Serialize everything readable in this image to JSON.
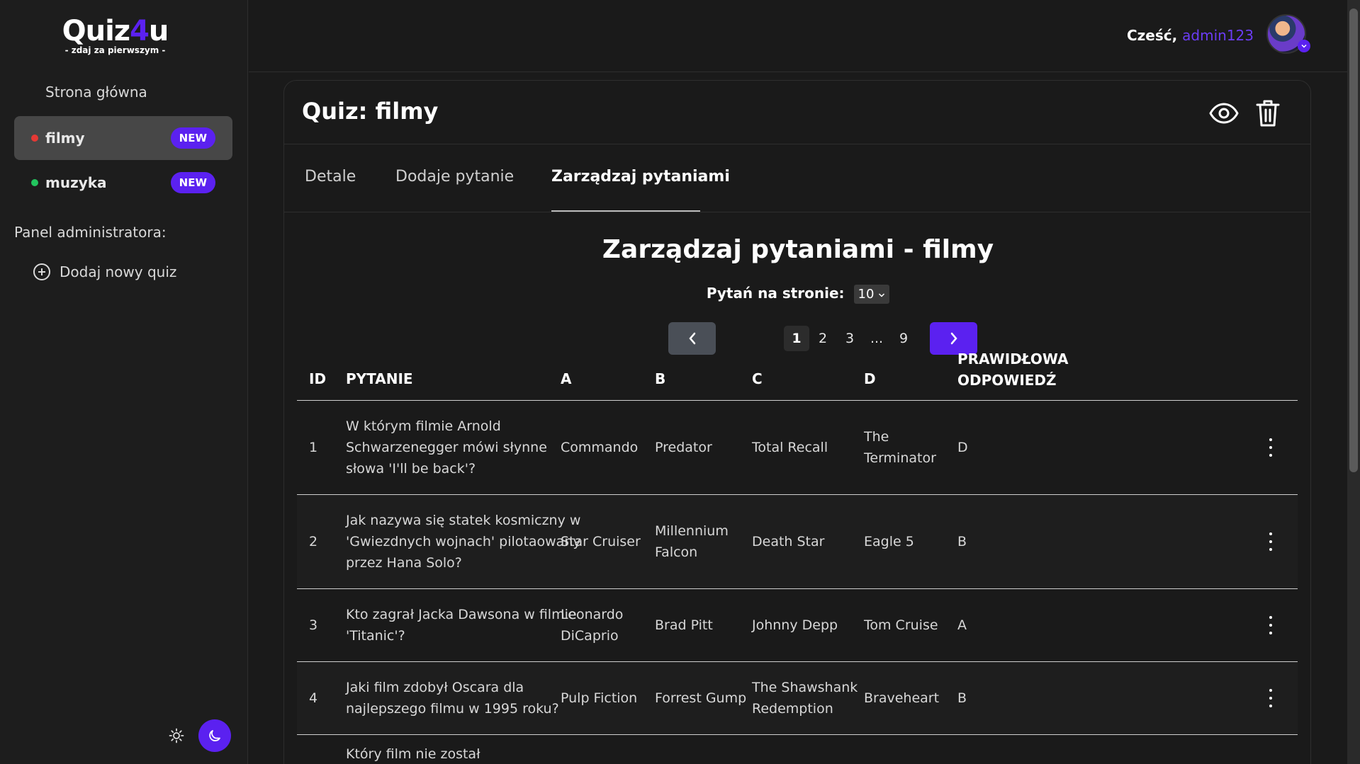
{
  "brand": {
    "title_main": "Quiz",
    "title_accent": "4",
    "title_end": "u",
    "tagline": "- zdaj za pierwszym -",
    "accent_color": "#5b21f0"
  },
  "sidebar": {
    "home": "Strona główna",
    "quizzes": [
      {
        "label": "filmy",
        "badge": "NEW",
        "dot_color": "#e53935",
        "active": true
      },
      {
        "label": "muzyka",
        "badge": "NEW",
        "dot_color": "#22c55e",
        "active": false
      }
    ],
    "admin_heading": "Panel administratora:",
    "add_quiz": "Dodaj nowy quiz"
  },
  "header": {
    "greeting": "Cześć,",
    "username": "admin123"
  },
  "card": {
    "title": "Quiz: filmy",
    "tabs": [
      "Detale",
      "Dodaje pytanie",
      "Zarządzaj pytaniami"
    ],
    "active_tab": 2,
    "section_title": "Zarządzaj pytaniami - filmy",
    "per_page_label": "Pytań na stronie:",
    "per_page_value": "10",
    "pagination": {
      "pages": [
        "1",
        "2",
        "3",
        "...",
        "9"
      ],
      "current": "1"
    }
  },
  "table": {
    "headers": {
      "id": "ID",
      "question": "PYTANIE",
      "a": "A",
      "b": "B",
      "c": "C",
      "d": "D",
      "correct_1": "PRAWIDŁOWA",
      "correct_2": "ODPOWIEDŹ"
    },
    "rows": [
      {
        "id": "1",
        "q": [
          "W którym filmie Arnold",
          "Schwarzenegger mówi słynne",
          "słowa 'I'll be back'?"
        ],
        "a": [
          "Commando"
        ],
        "b": [
          "Predator"
        ],
        "c": [
          "Total Recall"
        ],
        "d": [
          "The",
          "Terminator"
        ],
        "correct": "D"
      },
      {
        "id": "2",
        "q": [
          "Jak nazywa się statek kosmiczny w",
          "'Gwiezdnych wojnach' pilotaowany",
          "przez Hana Solo?"
        ],
        "a": [
          "Star Cruiser"
        ],
        "b": [
          "Millennium",
          "Falcon"
        ],
        "c": [
          "Death Star"
        ],
        "d": [
          "Eagle 5"
        ],
        "correct": "B"
      },
      {
        "id": "3",
        "q": [
          "Kto zagrał Jacka Dawsona w filmie",
          "'Titanic'?"
        ],
        "a": [
          "Leonardo",
          "DiCaprio"
        ],
        "b": [
          "Brad Pitt"
        ],
        "c": [
          "Johnny Depp"
        ],
        "d": [
          "Tom Cruise"
        ],
        "correct": "A"
      },
      {
        "id": "4",
        "q": [
          "Jaki film zdobył Oscara dla",
          "najlepszego filmu w 1995 roku?"
        ],
        "a": [
          "Pulp Fiction"
        ],
        "b": [
          "Forrest Gump"
        ],
        "c": [
          "The Shawshank",
          "Redemption"
        ],
        "d": [
          "Braveheart"
        ],
        "correct": "B"
      },
      {
        "id": "",
        "q": [
          "Który film nie został"
        ],
        "a": [],
        "b": [],
        "c": [],
        "d": [],
        "correct": ""
      }
    ]
  },
  "icons": {
    "view": "eye-icon",
    "delete": "trash-icon",
    "prev": "chevron-left-icon",
    "next": "chevron-right-icon",
    "theme_light": "sun-icon",
    "theme_dark": "moon-icon",
    "add": "plus-circle-icon",
    "row_menu": "kebab-menu-icon"
  }
}
